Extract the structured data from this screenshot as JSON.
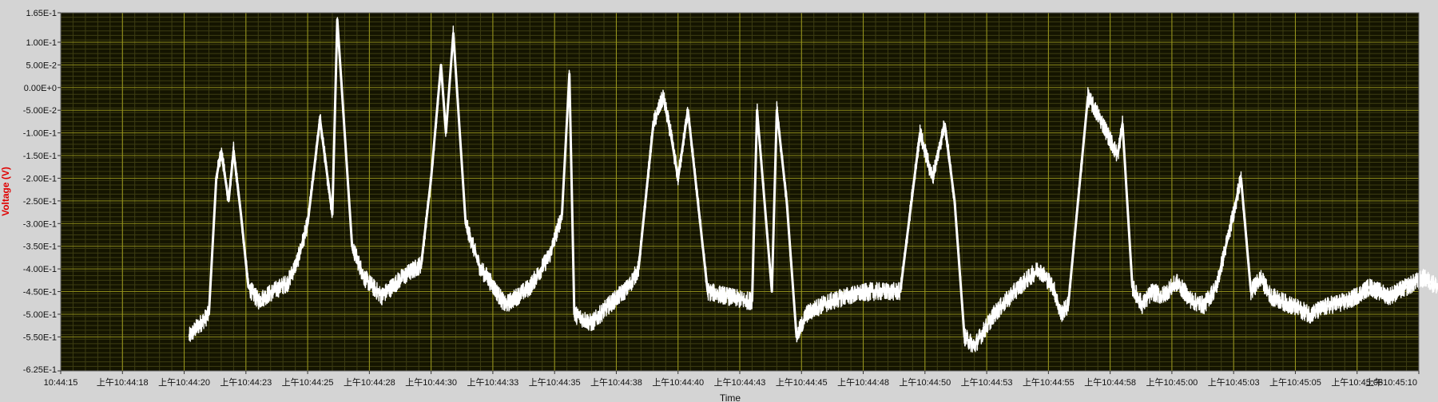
{
  "chart_data": {
    "type": "line",
    "title": "",
    "xlabel": "Time",
    "ylabel": "Voltage (V)",
    "ylim": [
      -0.625,
      0.165
    ],
    "grid": true,
    "y_ticks": [
      "1.65E-1",
      "1.00E-1",
      "5.00E-2",
      "0.00E+0",
      "-5.00E-2",
      "-1.00E-1",
      "-1.50E-1",
      "-2.00E-1",
      "-2.50E-1",
      "-3.00E-1",
      "-3.50E-1",
      "-4.00E-1",
      "-4.50E-1",
      "-5.00E-1",
      "-5.50E-1",
      "-6.25E-1"
    ],
    "y_tick_values": [
      0.165,
      0.1,
      0.05,
      0.0,
      -0.05,
      -0.1,
      -0.15,
      -0.2,
      -0.25,
      -0.3,
      -0.35,
      -0.4,
      -0.45,
      -0.5,
      -0.55,
      -0.625
    ],
    "x_ticks": [
      "10:44:15",
      "上午10:44:18",
      "上午10:44:20",
      "上午10:44:23",
      "上午10:44:25",
      "上午10:44:28",
      "上午10:44:30",
      "上午10:44:33",
      "上午10:44:35",
      "上午10:44:38",
      "上午10:44:40",
      "上午10:44:43",
      "上午10:44:45",
      "上午10:44:48",
      "上午10:44:50",
      "上午10:44:53",
      "上午10:44:55",
      "上午10:44:58",
      "上午10:45:00",
      "上午10:45:03",
      "上午10:45:05",
      "上午10:45:08",
      "上午10:45:10"
    ],
    "series": [
      {
        "color": "#ffffff",
        "x": [
          20.2,
          20.5,
          21.0,
          21.3,
          21.5,
          21.8,
          22.0,
          22.3,
          22.6,
          23.0,
          23.6,
          24.2,
          24.6,
          25.0,
          25.5,
          26.0,
          26.2,
          26.8,
          27.3,
          28.0,
          28.8,
          29.6,
          30.0,
          30.4,
          30.6,
          30.9,
          31.4,
          32.0,
          32.3,
          33.0,
          34.0,
          34.8,
          35.3,
          35.6,
          35.8,
          36.5,
          37.2,
          38.0,
          38.4,
          39.0,
          39.4,
          39.7,
          40.0,
          40.4,
          41.2,
          42.0,
          42.7,
          43.0,
          43.2,
          43.8,
          44.0,
          44.4,
          44.8,
          45.2,
          45.8,
          46.8,
          47.8,
          49.0,
          49.8,
          50.3,
          50.8,
          51.2,
          51.6,
          52.0,
          52.8,
          53.8,
          54.6,
          55.2,
          55.5,
          55.8,
          56.2,
          56.6,
          57.2,
          57.8,
          58.0,
          58.4,
          58.8,
          59.2,
          59.6,
          60.2,
          60.8,
          61.3,
          61.8,
          62.4,
          62.8,
          63.2,
          63.6,
          64.0,
          64.8,
          65.6,
          66.4,
          67.2,
          68.0,
          68.8,
          69.5,
          70.2,
          70.8
        ],
        "y": [
          -0.55,
          -0.53,
          -0.5,
          -0.2,
          -0.14,
          -0.25,
          -0.14,
          -0.28,
          -0.44,
          -0.47,
          -0.45,
          -0.43,
          -0.38,
          -0.3,
          -0.07,
          -0.28,
          0.15,
          -0.35,
          -0.42,
          -0.46,
          -0.42,
          -0.39,
          -0.2,
          0.05,
          -0.1,
          0.12,
          -0.3,
          -0.4,
          -0.42,
          -0.48,
          -0.44,
          -0.37,
          -0.28,
          0.03,
          -0.5,
          -0.52,
          -0.48,
          -0.44,
          -0.4,
          -0.08,
          -0.02,
          -0.1,
          -0.2,
          -0.05,
          -0.45,
          -0.46,
          -0.47,
          -0.47,
          -0.05,
          -0.45,
          -0.05,
          -0.25,
          -0.55,
          -0.5,
          -0.48,
          -0.46,
          -0.45,
          -0.45,
          -0.1,
          -0.2,
          -0.08,
          -0.25,
          -0.55,
          -0.57,
          -0.5,
          -0.44,
          -0.4,
          -0.44,
          -0.5,
          -0.48,
          -0.25,
          -0.02,
          -0.08,
          -0.15,
          -0.08,
          -0.44,
          -0.48,
          -0.45,
          -0.46,
          -0.43,
          -0.47,
          -0.48,
          -0.44,
          -0.3,
          -0.2,
          -0.45,
          -0.42,
          -0.46,
          -0.48,
          -0.5,
          -0.48,
          -0.47,
          -0.44,
          -0.46,
          -0.44,
          -0.42,
          -0.44
        ]
      }
    ]
  }
}
